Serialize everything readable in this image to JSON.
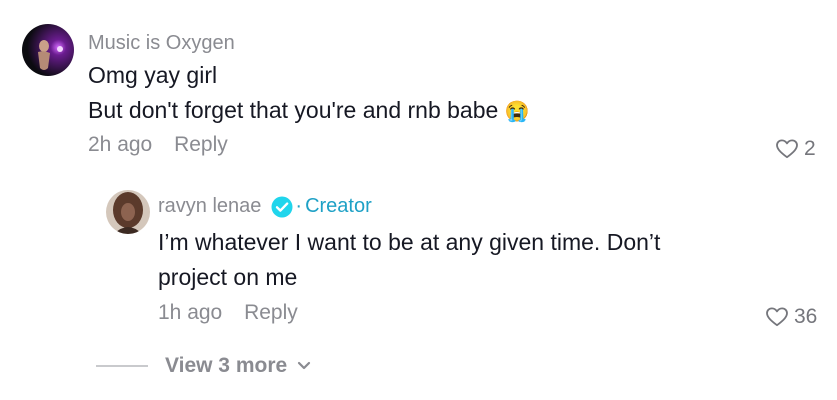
{
  "comments": [
    {
      "username": "Music is Oxygen",
      "lines": [
        "Omg yay girl",
        "But don't forget that you're and rnb babe"
      ],
      "emoji": "😭",
      "time": "2h ago",
      "reply_label": "Reply",
      "likes": "2",
      "icons": {
        "avatar": "avatar-image-icon",
        "like": "heart-outline-icon"
      }
    }
  ],
  "reply": {
    "username": "ravyn lenae",
    "badge_icon": "verified-check-icon",
    "badge_label": "Creator",
    "lines": [
      "I’m whatever I want to be at any given time. Don’t",
      "project on me"
    ],
    "time": "1h ago",
    "reply_label": "Reply",
    "likes": "36"
  },
  "view_more": {
    "label": "View 3 more",
    "icon": "chevron-down-icon"
  },
  "colors": {
    "muted": "#8a8b91",
    "text": "#161823",
    "creator": "#1fa1c6"
  }
}
